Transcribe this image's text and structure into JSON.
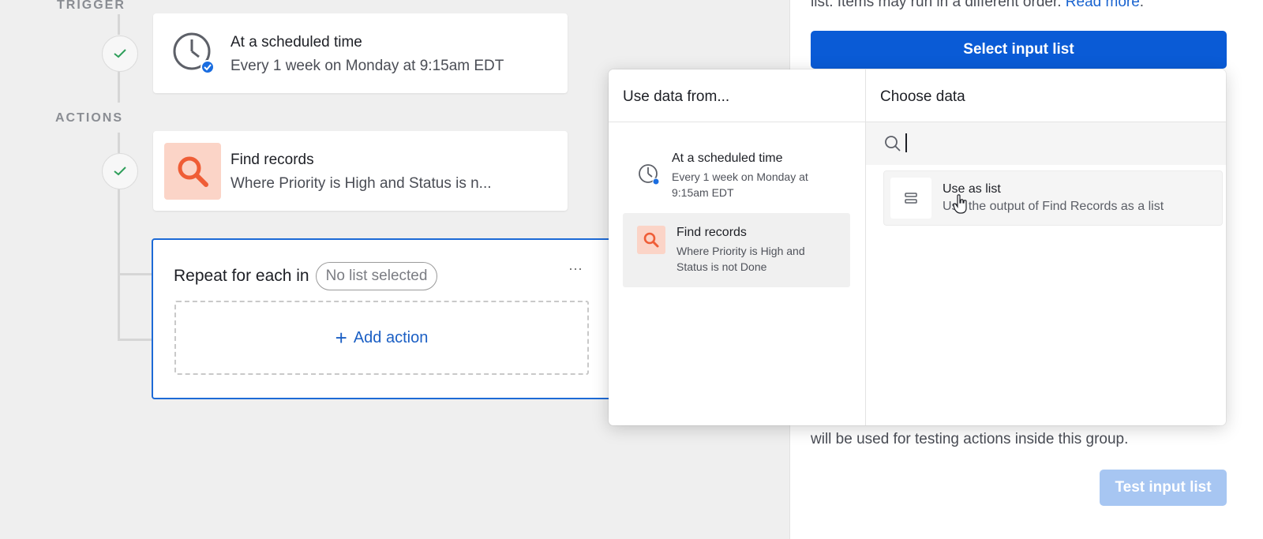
{
  "canvas": {
    "trigger_label": "TRIGGER",
    "actions_label": "ACTIONS",
    "trigger_card": {
      "title": "At a scheduled time",
      "subtitle": "Every 1 week on Monday at 9:15am EDT",
      "icon": "clock-icon"
    },
    "find_card": {
      "title": "Find records",
      "subtitle": "Where Priority is High and Status is n...",
      "icon": "search-icon"
    },
    "repeat_card": {
      "label": "Repeat for each in",
      "pill": "No list selected",
      "more": "···",
      "add_action": "Add action",
      "add_icon": "+"
    }
  },
  "right_panel": {
    "top_text_prefix": "list. Items may run in a different order.",
    "read_more": "Read more",
    "top_text_suffix": ".",
    "select_button": "Select input list",
    "bottom_text": "will be used for testing actions inside this group.",
    "test_button": "Test input list"
  },
  "popover": {
    "left_header": "Use data from...",
    "right_header": "Choose data",
    "search_placeholder": "",
    "sources": [
      {
        "title": "At a scheduled time",
        "subtitle_line1": "Every 1 week on Monday at",
        "subtitle_line2": "9:15am EDT",
        "icon": "clock-icon"
      },
      {
        "title": "Find records",
        "subtitle_line1": "Where Priority is High and",
        "subtitle_line2": "Status is not Done",
        "icon": "search-icon"
      }
    ],
    "option": {
      "title": "Use as list",
      "subtitle": "Use the output of Find Records as a list",
      "icon": "list-icon"
    }
  },
  "colors": {
    "accent": "#0a5bd6",
    "find_icon_bg": "#fbd4c7",
    "find_icon_fg": "#ef5d36",
    "check": "#2e9e5a"
  }
}
